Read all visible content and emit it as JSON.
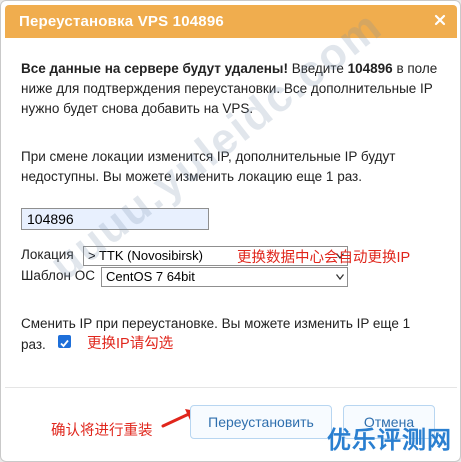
{
  "dialog": {
    "title": "Переустановка VPS 104896",
    "close_label": "×"
  },
  "warning": {
    "bold_prefix": "Все данные на сервере будут удалены!",
    "text_a": " Введите ",
    "bold_id": "104896",
    "text_b": " в поле ниже для подтверждения переустановки. Все дополнительные IP нужно будет снова добавить на VPS."
  },
  "location_note": "При смене локации изменится IP, дополнительные IP будут недоступны. Вы можете изменить локацию еще 1 раз.",
  "confirm_input": {
    "value": "104896"
  },
  "location": {
    "label": "Локация",
    "selected": "> TTK (Novosibirsk)",
    "annotation": "更换数据中心会自动更换IP"
  },
  "os_template": {
    "label": "Шаблон ОС",
    "selected": "CentOS 7 64bit"
  },
  "change_ip": {
    "text_a": "Сменить IP при переустановке. Вы можете изменить IP еще 1",
    "text_b": "раз.",
    "annotation": "更换IP请勾选"
  },
  "footer": {
    "annotation": "确认将进行重装",
    "reinstall_label": "Переустановить",
    "cancel_label": "Отмена"
  },
  "watermark": {
    "corner": "优乐评测网",
    "diagonal": "uuuu.yuleidc.com"
  },
  "colors": {
    "title_bar": "#f0ad4e",
    "annotation_red": "#e0261c",
    "button_text": "#2f6fae",
    "watermark_blue": "#2a7fd0"
  }
}
